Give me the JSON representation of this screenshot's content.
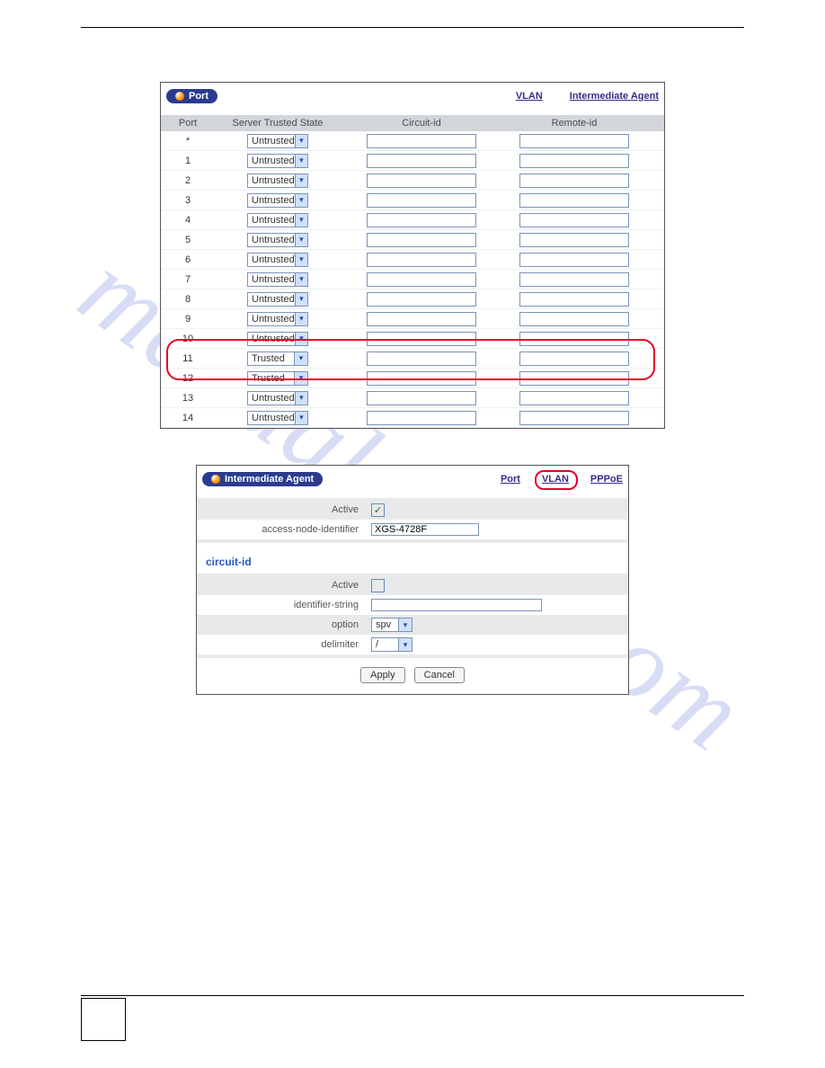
{
  "watermark_text": "manualshive.com",
  "port_panel": {
    "pill_label": "Port",
    "nav_vlan": "VLAN",
    "nav_agent": "Intermediate Agent",
    "header": {
      "port": "Port",
      "state": "Server Trusted State",
      "circuit": "Circuit-id",
      "remote": "Remote-id"
    },
    "rows": [
      {
        "port": "*",
        "state": "Untrusted"
      },
      {
        "port": "1",
        "state": "Untrusted"
      },
      {
        "port": "2",
        "state": "Untrusted"
      },
      {
        "port": "3",
        "state": "Untrusted"
      },
      {
        "port": "4",
        "state": "Untrusted"
      },
      {
        "port": "5",
        "state": "Untrusted"
      },
      {
        "port": "6",
        "state": "Untrusted"
      },
      {
        "port": "7",
        "state": "Untrusted"
      },
      {
        "port": "8",
        "state": "Untrusted"
      },
      {
        "port": "9",
        "state": "Untrusted"
      },
      {
        "port": "10",
        "state": "Untrusted"
      },
      {
        "port": "11",
        "state": "Trusted"
      },
      {
        "port": "12",
        "state": "Trusted"
      },
      {
        "port": "13",
        "state": "Untrusted"
      },
      {
        "port": "14",
        "state": "Untrusted"
      }
    ]
  },
  "agent_panel": {
    "pill_label": "Intermediate Agent",
    "nav_port": "Port",
    "nav_vlan": "VLAN",
    "nav_pppoe": "PPPoE",
    "top": {
      "active_label": "Active",
      "active_checked": true,
      "ani_label": "access-node-identifier",
      "ani_value": "XGS-4728F"
    },
    "section_title": "circuit-id",
    "circuit": {
      "active_label": "Active",
      "active_checked": false,
      "idstr_label": "identifier-string",
      "idstr_value": "",
      "option_label": "option",
      "option_value": "spv",
      "delim_label": "delimiter",
      "delim_value": "/"
    },
    "buttons": {
      "apply": "Apply",
      "cancel": "Cancel"
    }
  }
}
